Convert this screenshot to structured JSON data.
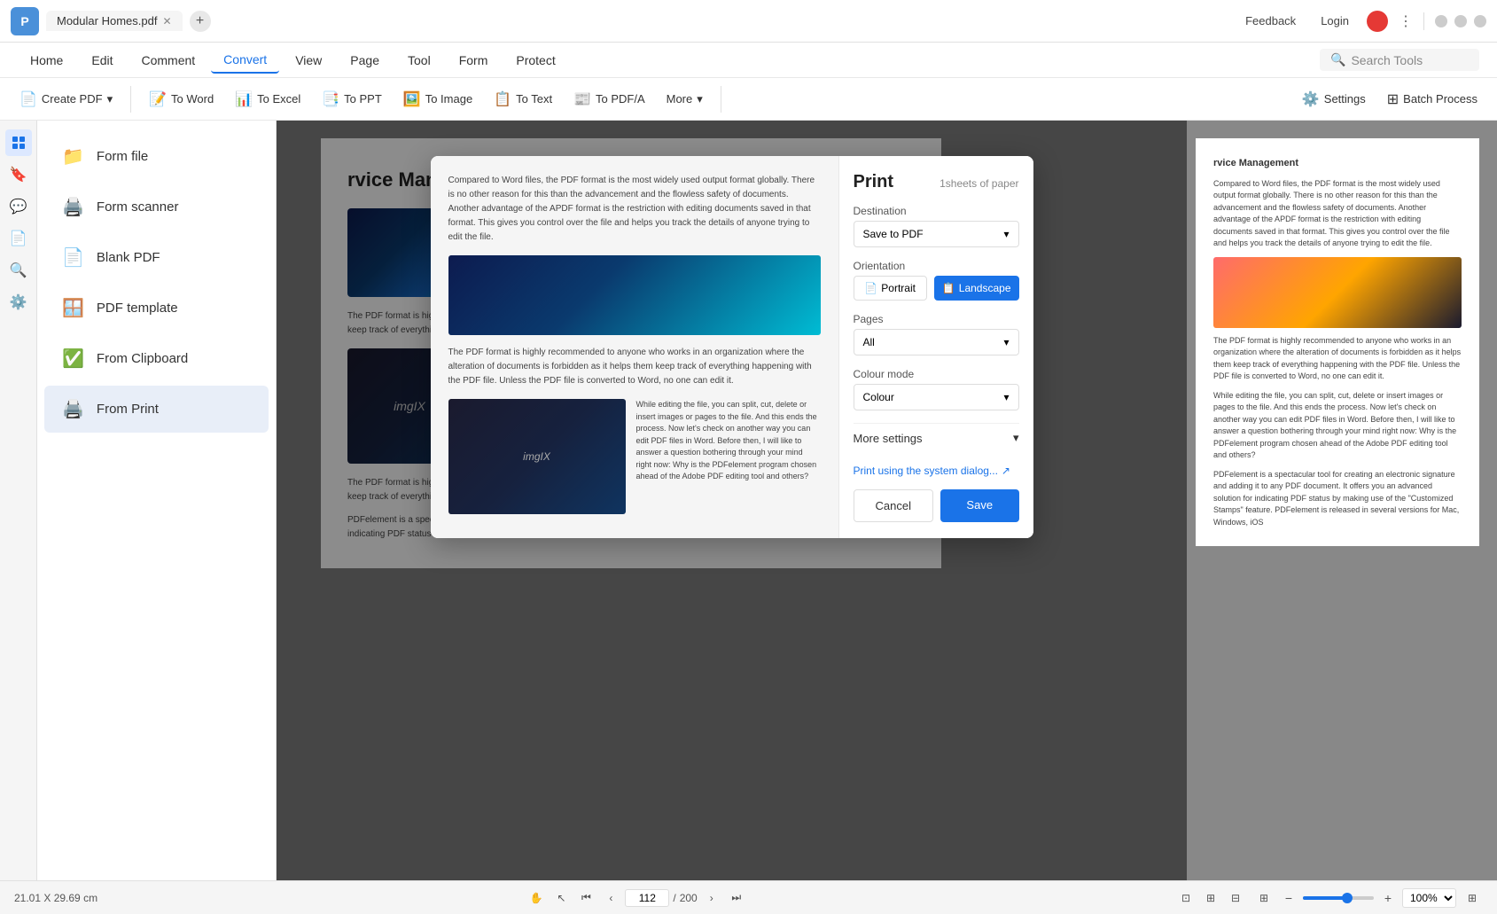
{
  "titlebar": {
    "logo": "P",
    "tab": "Modular Homes.pdf",
    "feedback": "Feedback",
    "login": "Login",
    "new_tab_title": "+"
  },
  "menubar": {
    "items": [
      {
        "label": "Home",
        "active": false
      },
      {
        "label": "Edit",
        "active": false
      },
      {
        "label": "Comment",
        "active": false
      },
      {
        "label": "Convert",
        "active": true
      },
      {
        "label": "View",
        "active": false
      },
      {
        "label": "Page",
        "active": false
      },
      {
        "label": "Tool",
        "active": false
      },
      {
        "label": "Form",
        "active": false
      },
      {
        "label": "Protect",
        "active": false
      }
    ],
    "search_placeholder": "Search Tools"
  },
  "toolbar": {
    "create_pdf": "Create PDF",
    "to_word": "To Word",
    "to_excel": "To Excel",
    "to_ppt": "To PPT",
    "to_image": "To Image",
    "to_text": "To Text",
    "to_pdfa": "To PDF/A",
    "more": "More",
    "settings": "Settings",
    "batch_process": "Batch Process"
  },
  "sidebar": {
    "items": [
      {
        "label": "Form file",
        "icon": "📁",
        "active": false
      },
      {
        "label": "Form scanner",
        "icon": "🖨️",
        "active": false
      },
      {
        "label": "Blank PDF",
        "icon": "📄",
        "active": false
      },
      {
        "label": "PDF template",
        "icon": "🪟",
        "active": false
      },
      {
        "label": "From Clipboard",
        "icon": "✅",
        "active": false
      },
      {
        "label": "From Print",
        "icon": "🖨️",
        "active": true
      }
    ]
  },
  "pdf": {
    "heading": "rvice Management",
    "body1": "Compared to Word files, the PDF format is the most widely used output format globally. There is no other reason for this than the advancement and the flowless safety of documents. Another advantage of the APDF format is the restriction with editing documents saved in that format. This gives you control over the file and helps you track the details of anyone trying to edit the file.",
    "body2": "The PDF format is highly recommended to anyone who works in an organization where the alteration of documents is forbidden as it helps them keep track of everything happening with the PDF file. Unless the PDF file is converted to Word, no one can edit it.",
    "body3": "While editing the file, you can split, cut, delete or insert images or pages to the file. And this ends the process. Now let's check on another way you can edit PDF files in Word. Before then, I will like to answer a question bothering through your mind right now: Why is the PDFelement program chosen ahead of the Adobe PDF editing tool and others?",
    "body4": "The PDF format is highly recommended to anyone who works in an organization where the alteration of documents is forbidden as it helps them keep track of everything happening with the PDF file. Unless the PDF file is converted to Word, no one can edit it.",
    "body5": "PDFelement is a spectacular tool for creating an electronic signature and adding it to any PDF document. It offers you an advanced solution for indicating PDF status by making use of the \"Customized Stamps\" feature. PDFelement is released in several versions for Mac, Windows, iOS",
    "img_alt": "imgIX"
  },
  "print_dialog": {
    "title": "Print",
    "sheets_info": "1sheets of paper",
    "destination_label": "Destination",
    "destination_value": "Save to PDF",
    "orientation_label": "Orientation",
    "portrait_label": "Portrait",
    "landscape_label": "Landscape",
    "pages_label": "Pages",
    "pages_value": "All",
    "colour_mode_label": "Colour mode",
    "colour_value": "Colour",
    "more_settings_label": "More settings",
    "system_dialog_label": "Print using the system dialog...",
    "cancel_label": "Cancel",
    "save_label": "Save"
  },
  "statusbar": {
    "dimensions": "21.01 X 29.69 cm",
    "current_page": "112",
    "total_pages": "200",
    "zoom_level": "100%"
  }
}
